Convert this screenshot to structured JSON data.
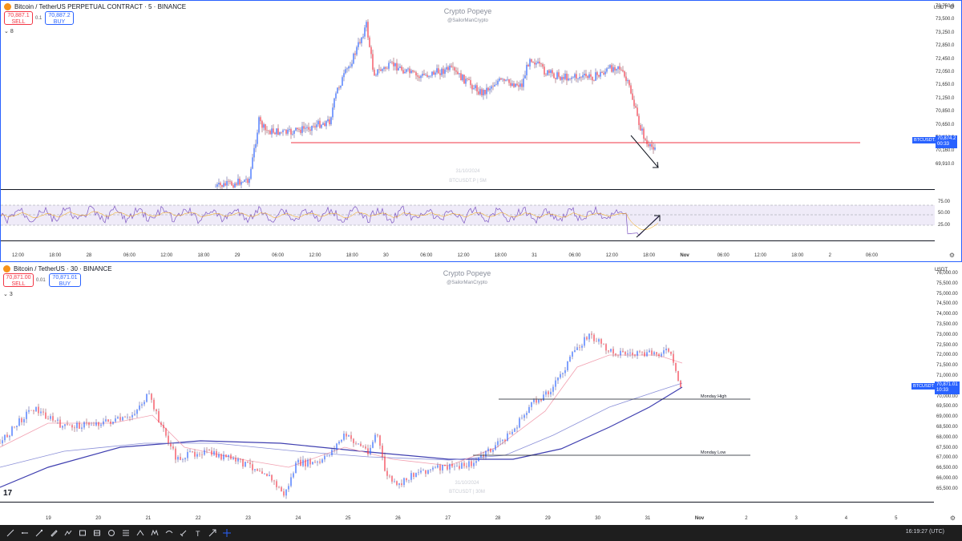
{
  "top_chart": {
    "title": "Bitcoin / TetherUS PERPETUAL CONTRACT · 5 · BINANCE",
    "sell_price": "70,887.1",
    "sell_label": "SELL",
    "spread": "0.1",
    "buy_price": "70,887.2",
    "buy_label": "BUY",
    "indicator_count": "8",
    "watermark_title": "Crypto Popeye",
    "watermark_handle": "@SailorManCrypto",
    "watermark_date": "31/10/2024",
    "watermark_symbol": "BTCUSDT.P | 5M",
    "currency": "USDT",
    "price_ticks": [
      "73,750.0",
      "73,500.0",
      "73,250.0",
      "72,850.0",
      "72,450.0",
      "72,050.0",
      "71,650.0",
      "71,250.0",
      "70,850.0",
      "70,650.0",
      "70,400.0",
      "70,160.0",
      "69,910.0"
    ],
    "symbol_tag": "BTCUSDT.P",
    "last_price": "70,874.2",
    "countdown": "00:33",
    "rsi_ticks": [
      "75.00",
      "50.00",
      "25.00"
    ],
    "time_ticks": [
      "12:00",
      "18:00",
      "28",
      "06:00",
      "12:00",
      "18:00",
      "29",
      "06:00",
      "12:00",
      "18:00",
      "30",
      "06:00",
      "12:00",
      "18:00",
      "31",
      "06:00",
      "12:00",
      "18:00",
      "Nov",
      "06:00",
      "12:00",
      "18:00",
      "2",
      "06:00"
    ],
    "red_line_color": "#f23645"
  },
  "bottom_chart": {
    "title": "Bitcoin / TetherUS · 30 · BINANCE",
    "sell_price": "70,871.00",
    "sell_label": "SELL",
    "spread": "0.01",
    "buy_price": "70,871.01",
    "buy_label": "BUY",
    "indicator_count": "3",
    "watermark_title": "Crypto Popeye",
    "watermark_handle": "@SailorManCrypto",
    "watermark_date": "31/10/2024",
    "watermark_symbol": "BTCUSDT | 30M",
    "currency": "USDT",
    "price_ticks": [
      "76,000.00",
      "75,500.00",
      "75,000.00",
      "74,500.00",
      "74,000.00",
      "73,500.00",
      "73,000.00",
      "72,500.00",
      "72,000.00",
      "71,500.00",
      "71,000.00",
      "70,500.00",
      "70,000.00",
      "69,500.00",
      "69,000.00",
      "68,500.00",
      "68,000.00",
      "67,500.00",
      "67,000.00",
      "66,500.00",
      "66,000.00",
      "65,500.00"
    ],
    "symbol_tag": "BTCUSDT",
    "last_price": "70,871.01",
    "countdown": "10:33",
    "monday_high_label": "Monday High",
    "monday_low_label": "Monday Low",
    "time_ticks": [
      "19",
      "20",
      "21",
      "22",
      "23",
      "24",
      "25",
      "26",
      "27",
      "28",
      "29",
      "30",
      "31",
      "Nov",
      "2",
      "3",
      "4",
      "5"
    ],
    "logo_text": "17"
  },
  "toolbar": {
    "tools": [
      "trendline-icon",
      "ray-icon",
      "brush-icon",
      "pen-icon",
      "path-icon",
      "rectangle-icon",
      "long-position-icon",
      "short-position-icon",
      "fib-icon",
      "pitchfork-icon",
      "pattern-icon",
      "elliott-icon",
      "measure-icon",
      "text-icon",
      "arrow-icon",
      "crosshair-icon"
    ],
    "clock": "16:19:27 (UTC)"
  }
}
